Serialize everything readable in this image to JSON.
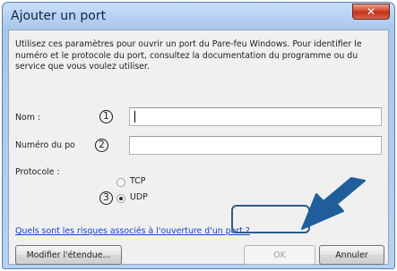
{
  "window": {
    "title": "Ajouter un port"
  },
  "description": "Utilisez ces paramètres pour ouvrir un port du Pare-feu Windows. Pour identifier le numéro et le protocole du port, consultez la documentation du programme ou du service que vous voulez utiliser.",
  "form": {
    "name_label": "Nom :",
    "name_value": "",
    "port_label": "Numéro du po",
    "port_value": "",
    "protocol_label": "Protocole :",
    "protocol_options": [
      "TCP",
      "UDP"
    ],
    "protocol_selected": "UDP"
  },
  "callouts": [
    "1",
    "2",
    "3"
  ],
  "link_text": "Quels sont les risques associés à l'ouverture d'un port ?",
  "buttons": {
    "modify_scope": "Modifier l'étendue...",
    "ok": "OK",
    "cancel": "Annuler"
  },
  "colors": {
    "arrow": "#1f5e9a",
    "highlight": "#2c5c8a",
    "link": "#1640c8"
  }
}
